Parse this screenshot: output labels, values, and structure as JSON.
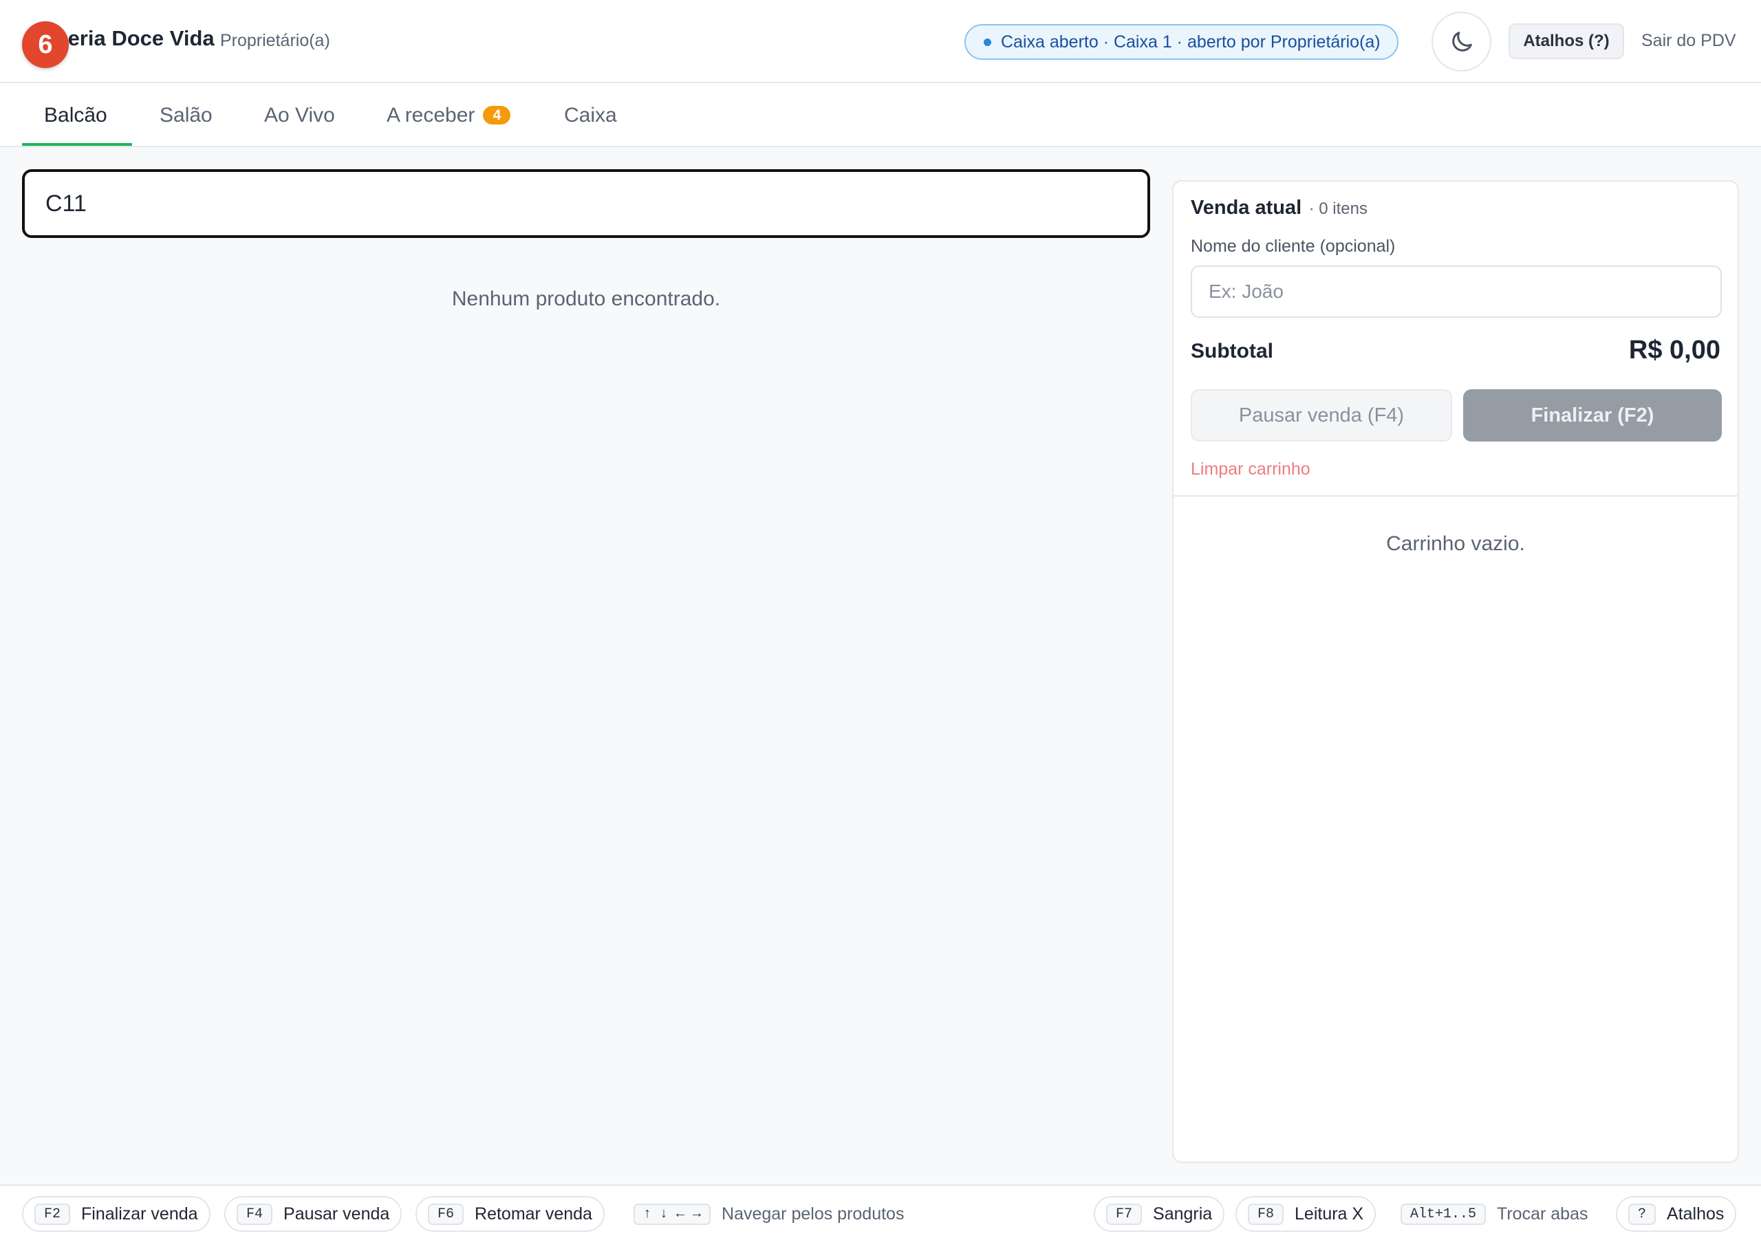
{
  "header": {
    "notification_count": "6",
    "brand": "Doceria Doce Vida",
    "role": "Proprietário(a)",
    "status": "Caixa aberto · Caixa 1 · aberto por Proprietário(a)",
    "theme_icon": "moon-icon",
    "shortcuts_label": "Atalhos (?)",
    "exit_label": "Sair do PDV"
  },
  "tabs": [
    {
      "label": "Balcão",
      "active": true
    },
    {
      "label": "Salão"
    },
    {
      "label": "Ao Vivo"
    },
    {
      "label": "A receber",
      "count": "4"
    },
    {
      "label": "Caixa"
    }
  ],
  "search": {
    "value": "C11",
    "empty_message": "Nenhum produto encontrado."
  },
  "cart": {
    "title": "Venda atual",
    "item_count": "· 0 itens",
    "customer_label": "Nome do cliente (opcional)",
    "customer_placeholder": "Ex: João",
    "subtotal_label": "Subtotal",
    "subtotal_value": "R$ 0,00",
    "pause_label": "Pausar venda (F4)",
    "finish_label": "Finalizar (F2)",
    "clear_label": "Limpar carrinho",
    "empty_message": "Carrinho vazio."
  },
  "footer": {
    "hints": [
      {
        "key": "F2",
        "label": "Finalizar venda"
      },
      {
        "key": "F4",
        "label": "Pausar venda"
      },
      {
        "key": "F6",
        "label": "Retomar venda"
      },
      {
        "key": "↑ ↓ ← →",
        "label": "Navegar pelos produtos"
      },
      {
        "key": "F7",
        "label": "Sangria"
      },
      {
        "key": "F8",
        "label": "Leitura X"
      },
      {
        "key": "Alt+1..5",
        "label": "Trocar abas"
      },
      {
        "key": "?",
        "label": "Atalhos"
      }
    ]
  },
  "colors": {
    "accent_green": "#22b35e",
    "badge_orange": "#f59a0b",
    "notification_red": "#e2462d",
    "status_blue": "#1a4f9c"
  }
}
